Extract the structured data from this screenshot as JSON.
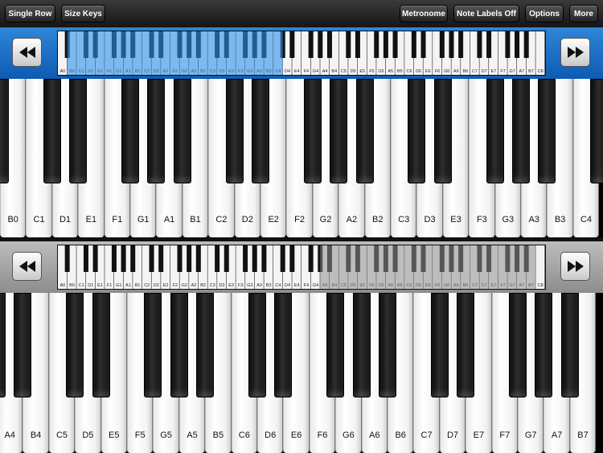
{
  "toolbar": {
    "single_row": "Single Row",
    "size_keys": "Size Keys",
    "metronome": "Metronome",
    "note_labels": "Note Labels Off",
    "options": "Options",
    "more": "More"
  },
  "navigator_labels": [
    "A0",
    "B0",
    "C1",
    "D1",
    "E1",
    "F1",
    "G1",
    "A1",
    "B1",
    "C2",
    "D2",
    "E2",
    "F2",
    "G2",
    "A2",
    "B2",
    "C3",
    "D3",
    "E3",
    "F3",
    "G3",
    "A3",
    "B3",
    "C4",
    "D4",
    "E4",
    "F4",
    "G4",
    "A4",
    "B4",
    "C5",
    "D5",
    "E5",
    "F5",
    "G5",
    "A5",
    "B5",
    "C6",
    "D6",
    "E6",
    "F6",
    "G6",
    "A6",
    "B6",
    "C7",
    "D7",
    "E7",
    "F7",
    "G7",
    "A7",
    "B7",
    "C8"
  ],
  "colors": {
    "top_strip": "#1e73c9",
    "bottom_strip": "#a6a6a6",
    "top_highlight": "#2f8fe8"
  },
  "top_keyboard": {
    "labels": [
      "B0",
      "C1",
      "D1",
      "E1",
      "F1",
      "G1",
      "A1",
      "B1",
      "C2",
      "D2",
      "E2",
      "F2",
      "G2",
      "A2",
      "B2",
      "C3",
      "D3",
      "E3",
      "F3",
      "G3",
      "A3",
      "B3",
      "C4"
    ]
  },
  "bottom_keyboard": {
    "labels": [
      "A4",
      "B4",
      "C5",
      "D5",
      "E5",
      "F5",
      "G5",
      "A5",
      "B5",
      "C6",
      "D6",
      "E6",
      "F6",
      "G6",
      "A6",
      "B6",
      "C7",
      "D7",
      "E7",
      "F7",
      "G7",
      "A7",
      "B7"
    ]
  }
}
